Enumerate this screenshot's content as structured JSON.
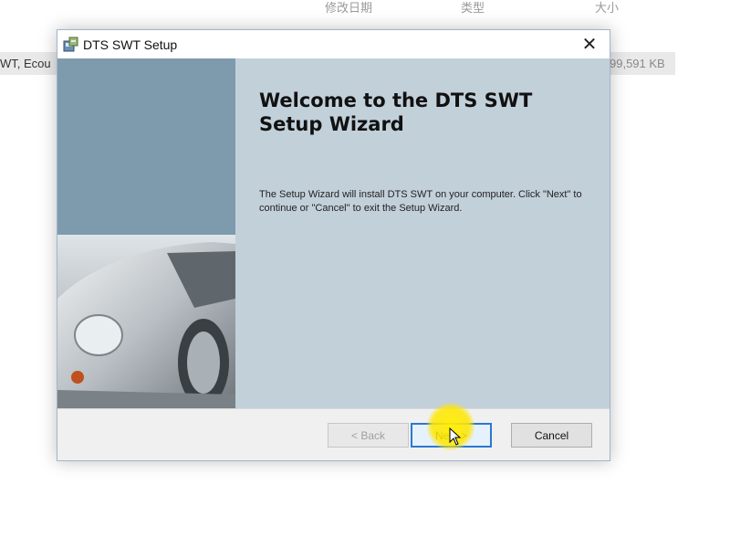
{
  "explorer": {
    "columns": [
      "修改日期",
      "类型",
      "大小"
    ],
    "file_row": {
      "name": "WT, Ecou",
      "size": "99,591 KB"
    }
  },
  "dialog": {
    "title": "DTS SWT Setup",
    "close_symbol": "✕",
    "welcome_title": "Welcome to the DTS SWT Setup Wizard",
    "welcome_body": "The Setup Wizard will install DTS SWT on your computer.  Click \"Next\" to continue or \"Cancel\" to exit the Setup Wizard.",
    "buttons": {
      "back": "< Back",
      "next": "Next >",
      "cancel": "Cancel"
    },
    "icons": {
      "app": "installer-icon",
      "close": "close-icon",
      "cursor": "mouse-cursor-icon"
    },
    "colors": {
      "left_panel": "#7e9aad",
      "main_panel": "#c2d0da",
      "focus_border": "#2e77d0",
      "click_highlight": "#ffe600"
    }
  }
}
